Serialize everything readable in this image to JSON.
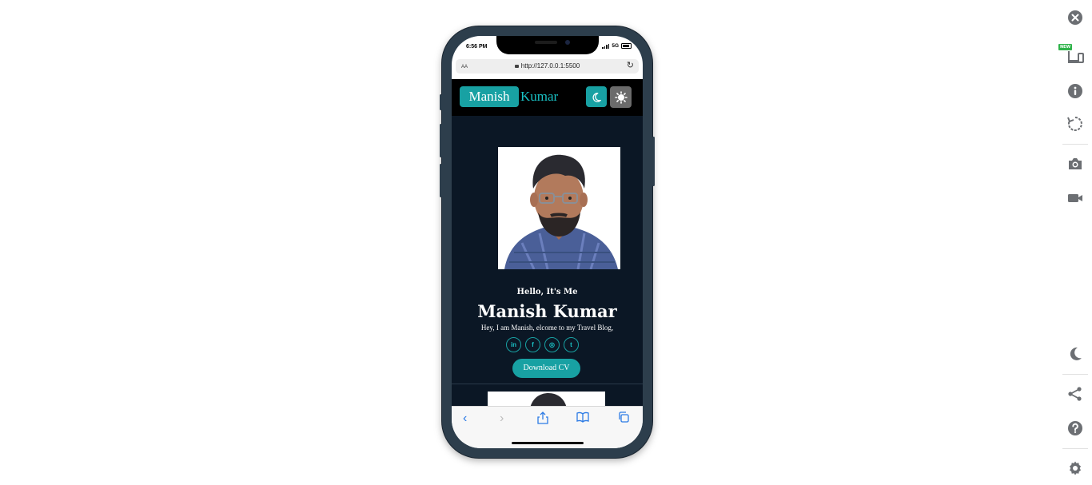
{
  "device": {
    "status_time": "6:56 PM",
    "network": "5G",
    "address_prefix": "AA",
    "url": "http://127.0.0.1:5500"
  },
  "site": {
    "logo_first": "Manish",
    "logo_last": "Kumar",
    "greeting": "Hello, It's Me",
    "name": "Manish Kumar",
    "tagline": "Hey, I am Manish, elcome to my Travel Blog,",
    "cv_button": "Download CV",
    "social_icons": [
      "linkedin-icon",
      "facebook-icon",
      "instagram-icon",
      "twitter-icon"
    ],
    "social_glyphs": [
      "in",
      "f",
      "◎",
      "t"
    ]
  },
  "tools": [
    "close-icon",
    "device-icon",
    "info-icon",
    "rotate-icon",
    "camera-icon",
    "video-icon",
    "dark-mode-icon",
    "share-icon",
    "help-icon",
    "settings-icon"
  ],
  "tools_badge": "NEW",
  "colors": {
    "accent": "#18a1a3",
    "page_bg": "#0b1725",
    "navbar_bg": "#000000",
    "tool_icon": "#6c6f73"
  }
}
